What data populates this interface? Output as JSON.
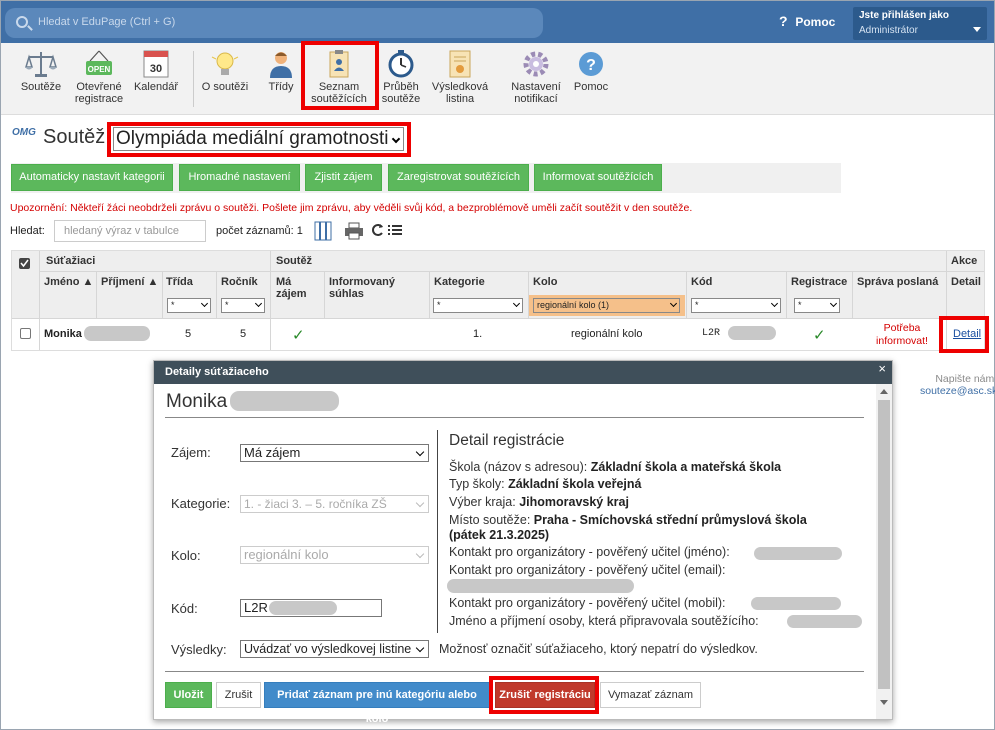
{
  "topbar": {
    "search_placeholder": "Hledat v EduPage (Ctrl + G)",
    "help_label": "Pomoc",
    "user_line1": "Jste přihlášen jako",
    "user_line2": "Administrátor"
  },
  "toolbar": {
    "items": [
      {
        "label": "Soutěže"
      },
      {
        "label": "Otevřené registrace",
        "badge": "OPEN"
      },
      {
        "label": "Kalendář",
        "badge": "30"
      },
      {
        "label": "O soutěži"
      },
      {
        "label": "Třídy"
      },
      {
        "label": "Seznam soutěžících"
      },
      {
        "label": "Průběh soutěže"
      },
      {
        "label": "Výsledková listina"
      },
      {
        "label": "Nastavení notifikací"
      },
      {
        "label": "Pomoc"
      }
    ]
  },
  "header": {
    "logo": "OMG",
    "label": "Soutěž:",
    "competition": "Olympiáda mediální gramotnosti"
  },
  "actions": {
    "auto_categories": "Automaticky nastavit kategorii",
    "bulk_settings": "Hromadné nastavení",
    "find_interest": "Zjistit zájem",
    "register": "Zaregistrovat soutěžících",
    "inform": "Informovat soutěžících"
  },
  "warning": "Upozornění: Někteří žáci neobdrželi zprávu o soutěži. Pošlete jim zprávu, aby věděli svůj kód, a bezproblémově uměli začít soutěžit v den soutěže.",
  "table_tools": {
    "search_label": "Hledat:",
    "search_placeholder": "hledaný výraz v tabulce",
    "count_label": "počet záznamů: 1"
  },
  "table": {
    "group_students": "Súťažiaci",
    "group_competition": "Soutěž",
    "group_action": "Akce",
    "columns": {
      "name": "Jméno",
      "surname": "Příjmení",
      "class": "Třída",
      "grade": "Ročník",
      "interest": "Má zájem",
      "consent": "Informovaný súhlas",
      "category": "Kategorie",
      "round": "Kolo",
      "code": "Kód",
      "registration": "Registrace",
      "message": "Správa poslaná",
      "detail": "Detail"
    },
    "filters": {
      "star": "*",
      "round": "regionální kolo (1)"
    },
    "row": {
      "name": "Monika",
      "class": "5",
      "grade": "5",
      "interest_mark": "✓",
      "category": "1.",
      "round": "regionální kolo",
      "code": "L2R",
      "registration_mark": "✓",
      "message": "Potřeba informovat!",
      "detail_link": "Detail"
    }
  },
  "side_note": {
    "line1": "Napište nám:",
    "email": "souteze@asc.sk"
  },
  "modal": {
    "title": "Detaily súťažiaceho",
    "close": "×",
    "student_name": "Monika",
    "fields": {
      "interest_label": "Zájem:",
      "interest_value": "Má zájem",
      "category_label": "Kategorie:",
      "category_value": "1. - žiaci 3. – 5. ročníka ZŠ",
      "round_label": "Kolo:",
      "round_value": "regionální kolo",
      "code_label": "Kód:",
      "code_value": "L2R",
      "results_label": "Výsledky:",
      "results_value": "Uvádzať vo výsledkovej listine",
      "results_note": "Možnosť označiť súťažiaceho, ktorý nepatrí do výsledkov."
    },
    "detail": {
      "heading": "Detail registrácie",
      "school_label": "Škola (názov s adresou):",
      "school_value": "Základní škola a mateřská škola",
      "type_label": "Typ školy:",
      "type_value": "Základní škola veřejná",
      "region_label": "Výber kraja:",
      "region_value": "Jihomoravský kraj",
      "venue_label": "Místo soutěže:",
      "venue_value": "Praha - Smíchovská střední průmyslová škola",
      "venue_date": "(pátek 21.3.2025)",
      "contact_name": "Kontakt pro organizátory - pověřený učitel (jméno):",
      "contact_email": "Kontakt pro organizátory - pověřený učitel (email):",
      "contact_mobile": "Kontakt pro organizátory - pověřený učitel (mobil):",
      "prepared_by": "Jméno a příjmení osoby, která připravovala soutěžícího:"
    },
    "buttons": {
      "save": "Uložit",
      "cancel": "Zrušit",
      "add_other": "Pridať záznam pre inú kategóriu alebo kolo",
      "cancel_registration": "Zrušiť registráciu",
      "delete": "Vymazať záznam"
    }
  },
  "colors": {
    "topbar": "#3f6fa6",
    "green": "#5cb85c",
    "highlight": "#e00000",
    "modal_header": "#3f4f5a",
    "round_filter": "#f5c08a"
  }
}
